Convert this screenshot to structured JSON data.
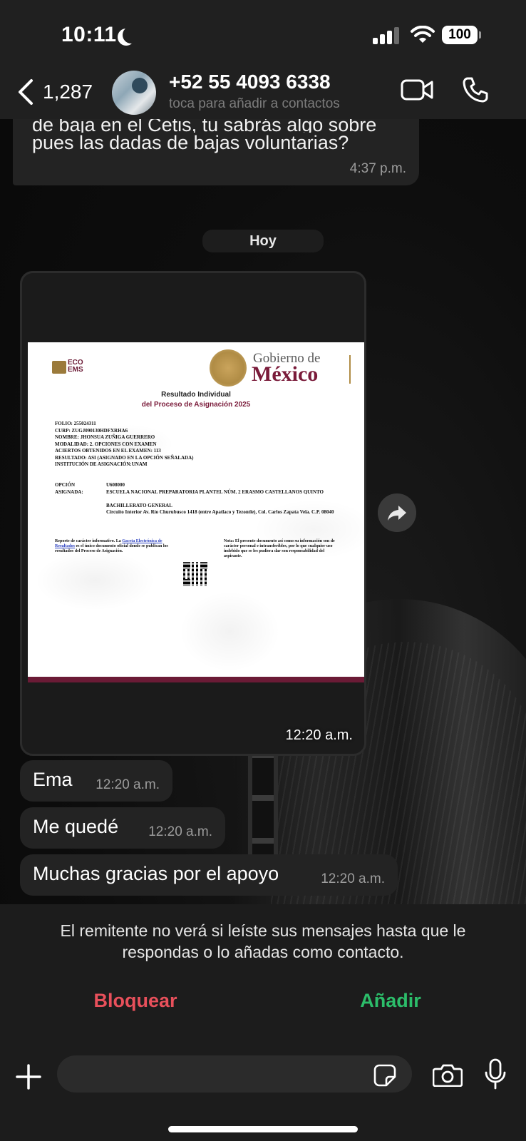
{
  "status_bar": {
    "time": "10:11",
    "battery": "100"
  },
  "header": {
    "back_count": "1,287",
    "contact_name": "+52 55 4093 6338",
    "contact_subtitle": "toca para añadir a contactos"
  },
  "previous_message": {
    "text_cut": "de baja en el Cetis, tu sabrás algo sobre",
    "text": "pues las dadas de bajas voluntarias?",
    "time": "4:37 p.m."
  },
  "date_separator": "Hoy",
  "document_message": {
    "time": "12:20 a.m.",
    "doc": {
      "eco_logo": "ECO EMS",
      "gob_line1": "Gobierno de",
      "gob_line2": "México",
      "title1": "Resultado Individual",
      "title2": "del Proceso de Asignación 2025",
      "fields": [
        "FOLIO: 255024311",
        "CURP: ZUGJ090130HDFXRHA6",
        "NOMBRE: JHONSUA ZUÑIGA GUERRERO",
        "MODALIDAD: 2. OPCIONES CON EXAMEN",
        "ACIERTOS OBTENIDOS EN EL EXAMEN: 113",
        "RESULTADO: ASI (ASIGNADO EN LA OPCIÓN SEÑALADA)",
        "INSTITUCIÓN DE ASIGNACIÓN:UNAM"
      ],
      "option_label": "OPCIÓN",
      "option_value": "U608000",
      "assigned_label": "ASIGNADA:",
      "assigned_value": "ESCUELA NACIONAL PREPARATORIA PLANTEL NÚM. 2 ERASMO CASTELLANOS QUINTO",
      "program": "BACHILLERATO GENERAL",
      "address": "Circuito Interior Av. Río Churubusco 1418 (entre Apatlaco y Tezontle), Col. Carlos Zapata Vela. C.P. 08040",
      "note_left_a": "Reporte de carácter informativo. La ",
      "note_left_link": "Gaceta Electrónica de Resultados",
      "note_left_b": " es el único documento oficial donde se publican los resultados del Proceso de Asignación.",
      "note_right": "Nota: El presente documento así como su información son de carácter personal e intransferibles, por lo que cualquier uso indebido que se les pudiera dar son responsabilidad del aspirante."
    }
  },
  "messages": [
    {
      "text": "Ema",
      "time": "12:20 a.m."
    },
    {
      "text": "Me quedé",
      "time": "12:20 a.m."
    },
    {
      "text": "Muchas gracias por el apoyo",
      "time": "12:20 a.m."
    }
  ],
  "notice": {
    "text": "El remitente no verá si leíste sus mensajes hasta que le respondas o lo añadas como contacto.",
    "block_label": "Bloquear",
    "add_label": "Añadir"
  },
  "composer": {
    "placeholder": ""
  },
  "colors": {
    "block": "#e8505b",
    "add": "#2cbd6a",
    "gob_wine": "#7a1b3a"
  },
  "icons": [
    "back-icon",
    "video-icon",
    "phone-icon",
    "share-icon",
    "plus-icon",
    "sticker-icon",
    "camera-icon",
    "mic-icon"
  ]
}
